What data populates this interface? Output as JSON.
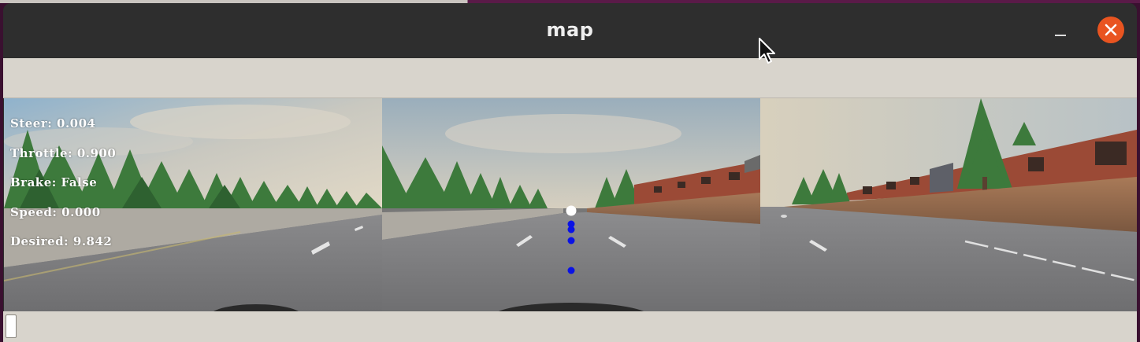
{
  "window": {
    "title": "map"
  },
  "hud": {
    "steer": "Steer: 0.004",
    "throttle": "Throttle: 0.900",
    "brake": "Brake: False",
    "speed": "Speed: 0.000",
    "desired": "Desired: 9.842"
  },
  "colors": {
    "titlebar": "#2e2e2e",
    "close_button": "#e95420",
    "toolbar": "#d8d4cc",
    "waypoint": "#0000ff",
    "target_waypoint": "#ffffff"
  },
  "icons": {
    "close": "close-icon",
    "minimize": "minimize-icon",
    "cursor": "mouse-pointer-icon"
  }
}
